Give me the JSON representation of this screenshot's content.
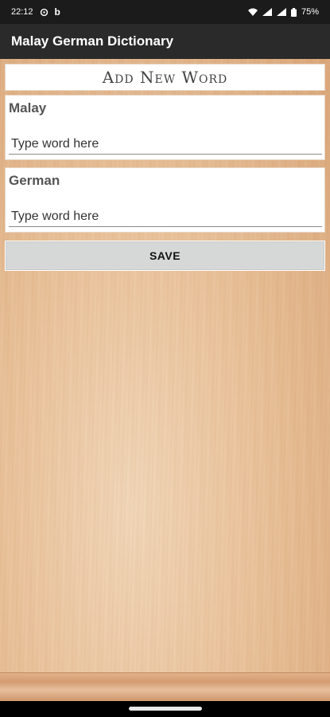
{
  "status_bar": {
    "time": "22:12",
    "battery": "75%",
    "icons": [
      "sync-icon",
      "b-app-icon",
      "wifi-icon",
      "signal-icon",
      "signal-icon",
      "battery-icon"
    ]
  },
  "app_bar": {
    "title": "Malay German Dictionary"
  },
  "form": {
    "header": "Add New Word",
    "malay_label": "Malay",
    "malay_placeholder": "Type word here",
    "german_label": "German",
    "german_placeholder": "Type word here",
    "save_label": "SAVE"
  }
}
